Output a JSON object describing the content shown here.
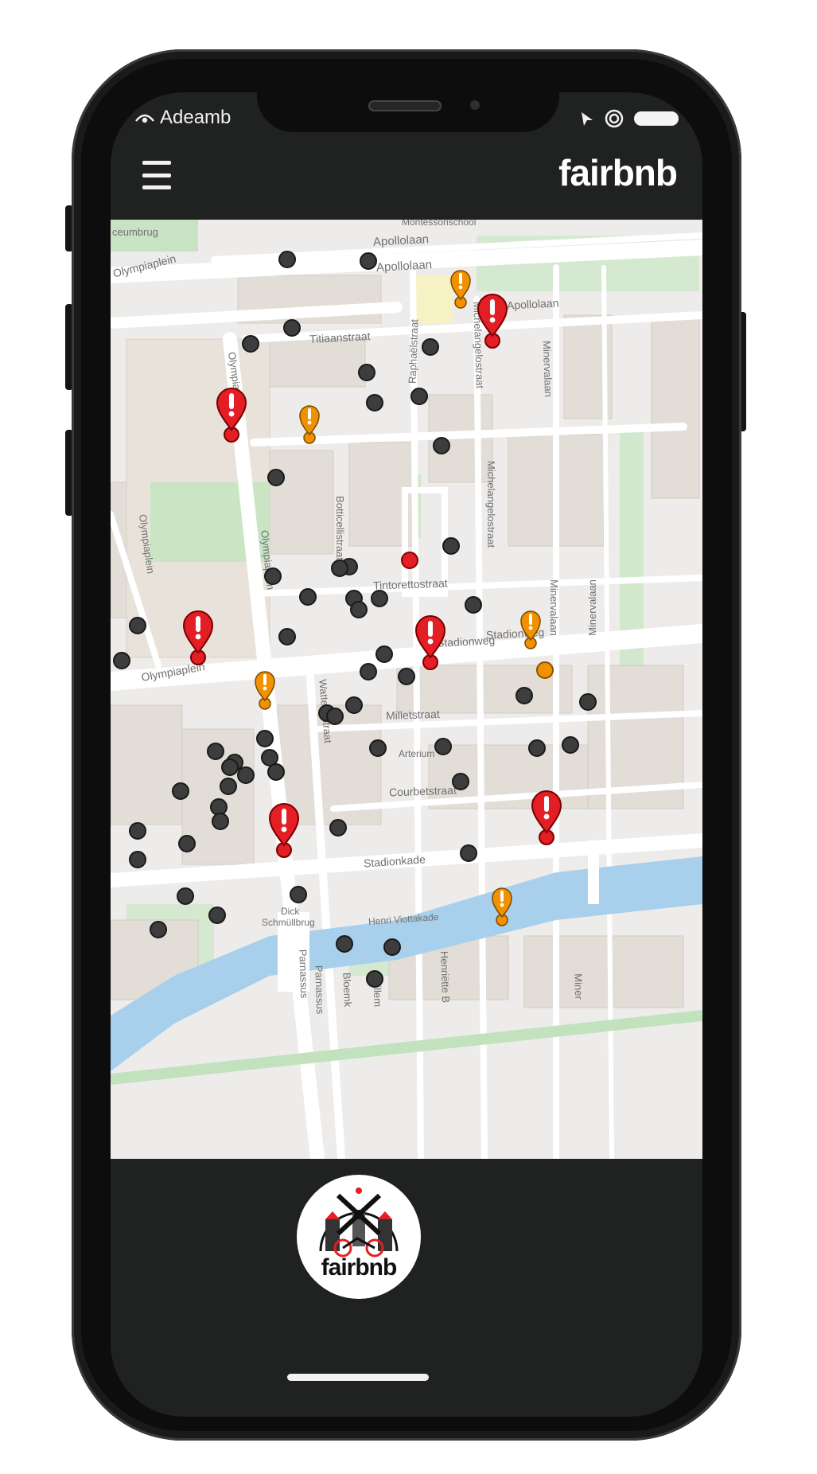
{
  "status_bar": {
    "carrier": "Adeamb"
  },
  "app": {
    "brand": "fairbnb",
    "logo_text": "fairbnb"
  },
  "colors": {
    "accent_red": "#e31e24",
    "accent_orange": "#f29100",
    "listing_dot": "#3d3d3d"
  },
  "map": {
    "streets": [
      "ceumbrug",
      "Montessorischool",
      "Apollolaan",
      "Apollolaan",
      "Olympiaplein",
      "Titiaanstraat",
      "Raphaëlstraat",
      "Michelangelostraat",
      "Apollolaan",
      "Minervalaan",
      "Olympiaplein",
      "Botticellistraat",
      "Michelangelostraat",
      "Olympiaplein",
      "Olympiaplein",
      "Tintorettostraat",
      "Minervalaan",
      "Minervalaan",
      "Stadionweg",
      "Stadionweg",
      "Olympiaplein",
      "Watteaustraat",
      "Milletstraat",
      "Arterium",
      "Courbetstraat",
      "Stadionkade",
      "Dick",
      "Schmüllbrug",
      "Henri Viottakade",
      "Parnassus",
      "Parnassus",
      "Bloemk",
      "Willem",
      "Henriëtte B",
      "Miner"
    ]
  }
}
